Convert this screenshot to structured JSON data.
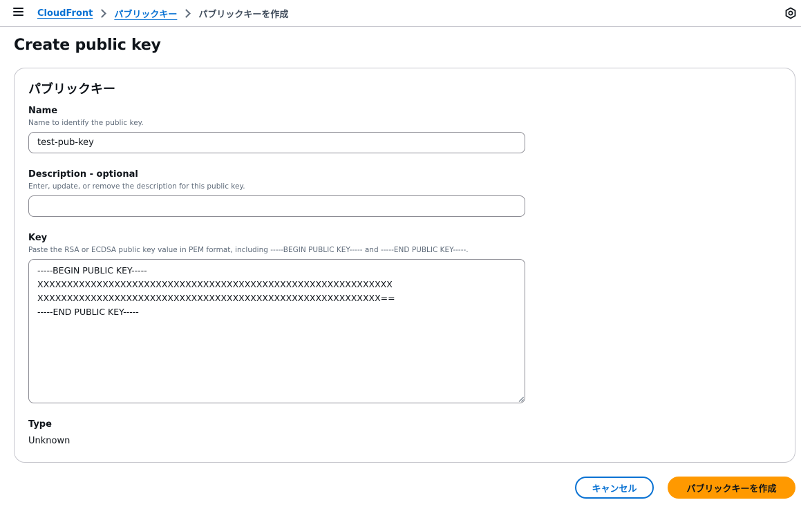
{
  "breadcrumb": {
    "items": [
      "CloudFront",
      "パブリックキー"
    ],
    "current": "パブリックキーを作成"
  },
  "page": {
    "title": "Create public key"
  },
  "container": {
    "title": "パブリックキー"
  },
  "fields": {
    "name": {
      "label": "Name",
      "description": "Name to identify the public key.",
      "value": "test-pub-key"
    },
    "description": {
      "label": "Description - optional",
      "description": "Enter, update, or remove the description for this public key.",
      "value": ""
    },
    "key": {
      "label": "Key",
      "description": "Paste the RSA or ECDSA public key value in PEM format, including -----BEGIN PUBLIC KEY----- and -----END PUBLIC KEY-----.",
      "value": "-----BEGIN PUBLIC KEY-----\nXXXXXXXXXXXXXXXXXXXXXXXXXXXXXXXXXXXXXXXXXXXXXXXXXXXXXXXXXXXX\nXXXXXXXXXXXXXXXXXXXXXXXXXXXXXXXXXXXXXXXXXXXXXXXXXXXXXXXXXX==\n-----END PUBLIC KEY-----"
    },
    "type": {
      "label": "Type",
      "value": "Unknown"
    }
  },
  "actions": {
    "cancel_label": "キャンセル",
    "create_label": "パブリックキーを作成"
  },
  "colors": {
    "link": "#0972d3",
    "primary": "#ff9900",
    "border": "#c6c6cd",
    "input_border": "#8c8c94",
    "muted_text": "#5f6b7a"
  },
  "icons": {
    "menu": "hamburger-menu-icon",
    "separator": "chevron-right-icon",
    "notifications": "hexagon-notification-icon"
  }
}
